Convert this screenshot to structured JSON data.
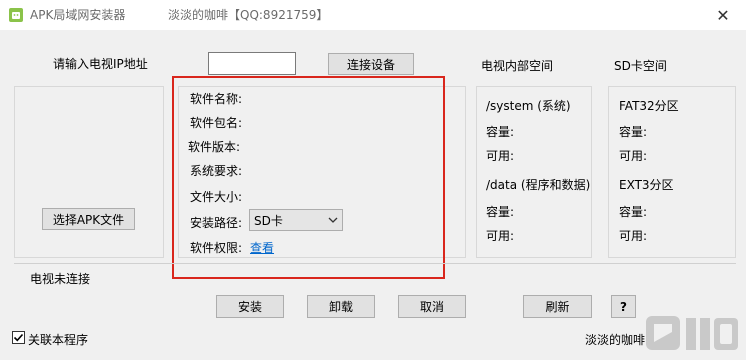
{
  "window": {
    "title": "APK局域网安装器",
    "subtitle": "淡淡的咖啡【QQ:8921759】",
    "close_glyph": "✕"
  },
  "connect": {
    "ip_label": "请输入电视IP地址",
    "ip_value": "",
    "connect_button": "连接设备"
  },
  "left_panel": {
    "choose_apk_button": "选择APK文件"
  },
  "info": {
    "name_label": "软件名称:",
    "package_label": "软件包名:",
    "version_label": "软件版本:",
    "requirement_label": "系统要求:",
    "size_label": "文件大小:",
    "install_path_label": "安装路径:",
    "install_path_value": "SD卡",
    "permission_label": "软件权限:",
    "permission_link": "查看"
  },
  "tv_storage": {
    "header": "电视内部空间",
    "system_label": "/system (系统)",
    "system_capacity": "容量:",
    "system_available": "可用:",
    "data_label": "/data (程序和数据)",
    "data_capacity": "容量:",
    "data_available": "可用:"
  },
  "sd_storage": {
    "header": "SD卡空间",
    "fat32_label": "FAT32分区",
    "fat32_capacity": "容量:",
    "fat32_available": "可用:",
    "ext3_label": "EXT3分区",
    "ext3_capacity": "容量:",
    "ext3_available": "可用:"
  },
  "status": {
    "connection": "电视未连接"
  },
  "actions": {
    "install": "安装",
    "uninstall": "卸载",
    "cancel": "取消",
    "refresh": "刷新",
    "help": "?"
  },
  "footer": {
    "associate_checkbox_label": "关联本程序",
    "associate_checked": true,
    "author": "淡淡的咖啡"
  },
  "colors": {
    "highlight_border": "#d9261c",
    "link": "#0066cc",
    "window_bg": "#f0f0f0"
  }
}
